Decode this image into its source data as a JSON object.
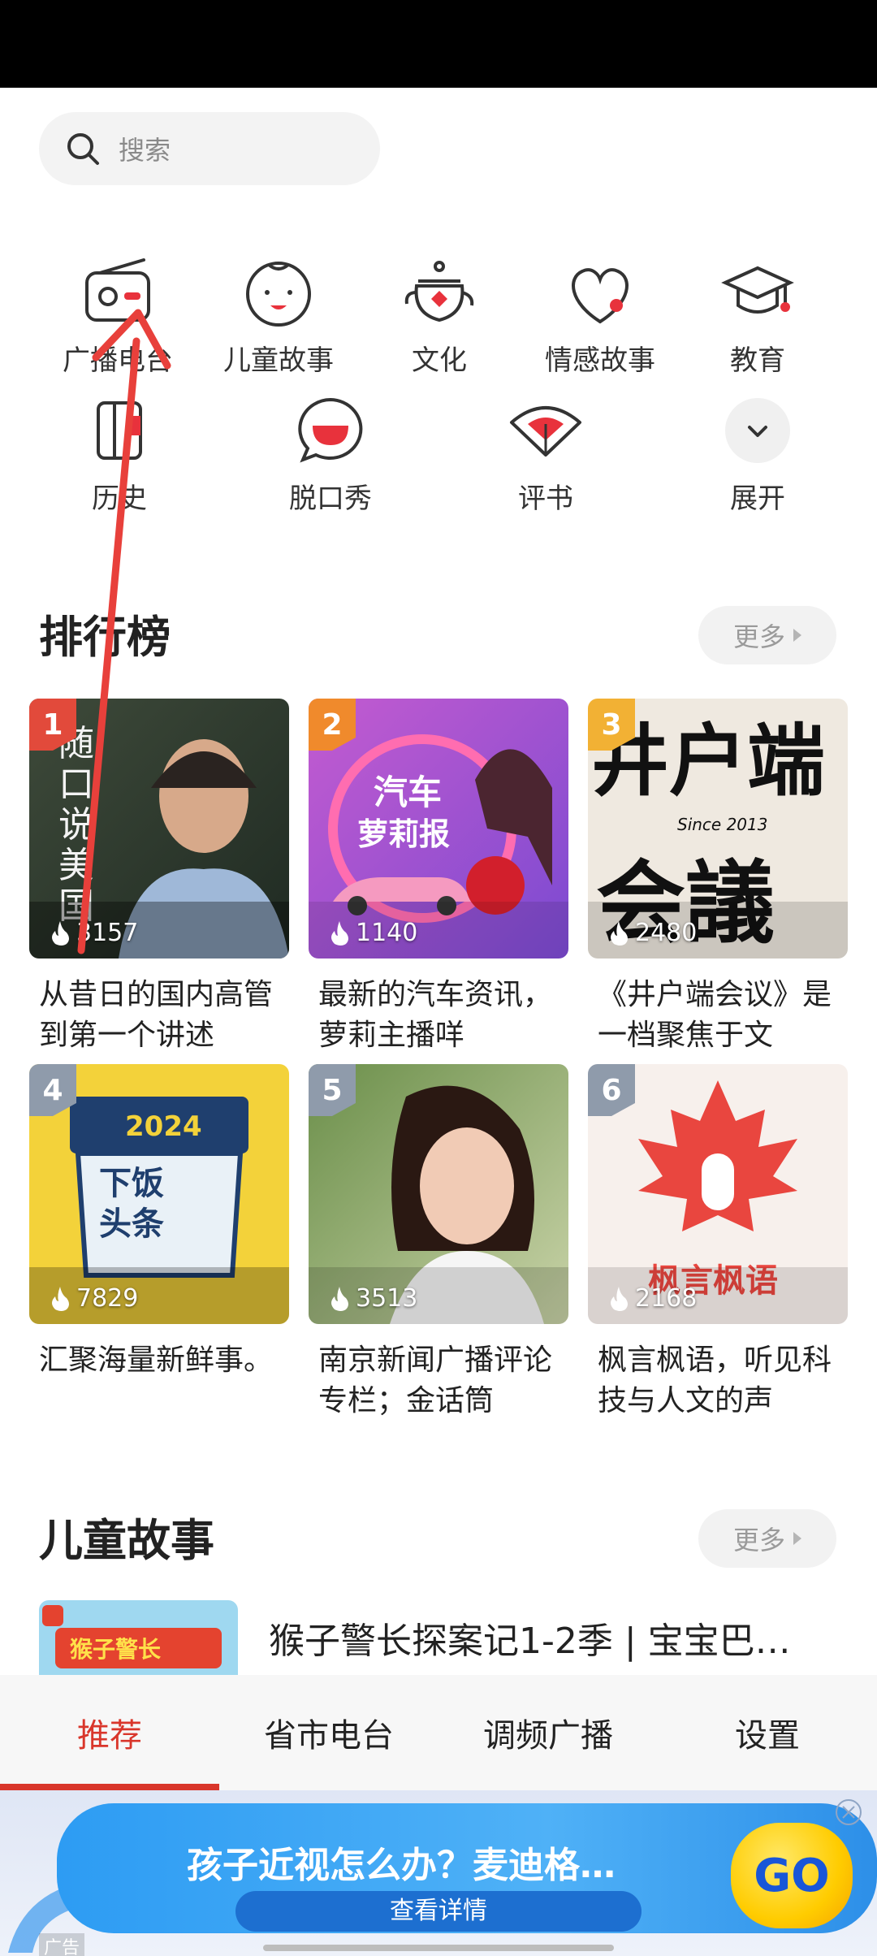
{
  "search": {
    "placeholder": "搜索"
  },
  "categories": [
    {
      "label": "广播电台",
      "icon": "radio-icon"
    },
    {
      "label": "儿童故事",
      "icon": "child-face-icon"
    },
    {
      "label": "文化",
      "icon": "teapot-icon"
    },
    {
      "label": "情感故事",
      "icon": "heart-icon"
    },
    {
      "label": "教育",
      "icon": "graduation-cap-icon"
    },
    {
      "label": "历史",
      "icon": "scroll-icon"
    },
    {
      "label": "脱口秀",
      "icon": "speech-bubble-icon"
    },
    {
      "label": "评书",
      "icon": "fan-icon"
    },
    {
      "label": "展开",
      "icon": "chevron-down-icon"
    }
  ],
  "ranking": {
    "title": "排行榜",
    "more": "更多",
    "items": [
      {
        "rank": "1",
        "plays": "3157",
        "desc": "从昔日的国内高管到第一个讲述",
        "cover_text": "随口说美国",
        "badge_color": "#e24a3b"
      },
      {
        "rank": "2",
        "plays": "1140",
        "desc": "最新的汽车资讯，萝莉主播咩",
        "cover_text": "汽车萝莉报",
        "badge_color": "#f08a2c"
      },
      {
        "rank": "3",
        "plays": "2480",
        "desc": "《井户端会议》是一档聚焦于文",
        "cover_text": "井户端会議",
        "badge_color": "#f2b134"
      },
      {
        "rank": "4",
        "plays": "7829",
        "desc": "汇聚海量新鲜事。",
        "cover_text": "下饭头条",
        "badge_color": "#8f9bab"
      },
      {
        "rank": "5",
        "plays": "3513",
        "desc": "南京新闻广播评论专栏；金话筒",
        "cover_text": "",
        "badge_color": "#8f9bab"
      },
      {
        "rank": "6",
        "plays": "2168",
        "desc": "枫言枫语，听见科技与人文的声",
        "cover_text": "枫言枫语",
        "badge_color": "#8f9bab"
      }
    ]
  },
  "kids": {
    "title": "儿童故事",
    "more": "更多",
    "first_item": "猴子警长探案记1-2季 | 宝宝巴…"
  },
  "tabs": [
    {
      "label": "推荐",
      "active": true
    },
    {
      "label": "省市电台",
      "active": false
    },
    {
      "label": "调频广播",
      "active": false
    },
    {
      "label": "设置",
      "active": false
    }
  ],
  "ad": {
    "headline": "孩子近视怎么办？麦迪格…",
    "cta": "查看详情",
    "go": "GO",
    "label": "广告"
  },
  "colors": {
    "accent": "#d9362b",
    "icon_red": "#e8323c"
  }
}
